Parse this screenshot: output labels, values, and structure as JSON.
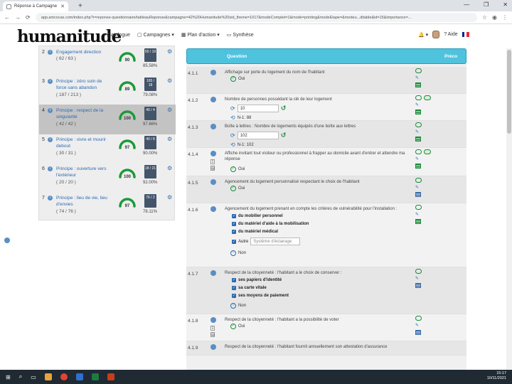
{
  "browser": {
    "tab_title": "Réponse à Campagne",
    "new_tab": "+",
    "controls": [
      "—",
      "❐",
      "✕"
    ],
    "url": "app.amcocas.com/index.php?r=reponse-questionnaire/tableauReponse&campagne=42%20Humanitude%20sid_theme=1017&modeComplet=1&mode=printing&modeEtape=&modeu...ditable&id=15&importance=..."
  },
  "appnav": {
    "logo": "humanitude",
    "menu": [
      {
        "icon": "≡",
        "label": "Catalogue"
      },
      {
        "icon": "▢",
        "label": "Campagnes ▾"
      },
      {
        "icon": "▦",
        "label": "Plan d'action ▾"
      },
      {
        "icon": "▭",
        "label": "Synthèse"
      }
    ],
    "bell": "🔔 ▾",
    "help": "Aide",
    "flag_colors": [
      "#002395",
      "#ffffff",
      "#ed2939"
    ]
  },
  "left_items": [
    {
      "num": "2",
      "title": "Engagement direction",
      "count": "( 62 / 63 )",
      "gauge": "90",
      "mini": "50 / 19",
      "pct": "85.58%",
      "highlight": false
    },
    {
      "num": "3",
      "title": "Principe : zéro soin de force sans abandon",
      "count": "( 187 / 213 )",
      "gauge": "89",
      "mini": "165 / 18",
      "pct": "79.08%",
      "highlight": false
    },
    {
      "num": "4",
      "title": "Principe : respect de la singularité",
      "count": "( 42 / 42 )",
      "gauge": "100",
      "mini": "40 / 4",
      "pct": "97.66%",
      "highlight": true
    },
    {
      "num": "5",
      "title": "Principe : vivre et mourir debout",
      "count": "( 30 / 31 )",
      "gauge": "97",
      "mini": "40 / 8",
      "pct": "90.00%",
      "highlight": false
    },
    {
      "num": "6",
      "title": "Principe : ouverture vers l'extérieur",
      "count": "( 20 / 20 )",
      "gauge": "100",
      "mini": "18 / 21",
      "pct": "92.00%",
      "highlight": false
    },
    {
      "num": "7",
      "title": "Principe : lieu de vie, lieu d'envies",
      "count": "( 74 / 76 )",
      "gauge": "97",
      "mini": "76 / 2",
      "pct": "78.11%",
      "highlight": false
    }
  ],
  "table": {
    "col_question": "Question",
    "col_preco": "Préco"
  },
  "questions": [
    {
      "id": "4.1.1",
      "text": "Affichage sur porte du logement du nom de l'habitant",
      "answer": "Oui"
    },
    {
      "id": "4.1.2",
      "text": "Nombre de personnes possédant la clé de leur logement",
      "value": "10",
      "n1": "N-1: 88"
    },
    {
      "id": "4.1.3",
      "text": "Boîte à lettres : Nombre de logements équipés d'une boîte aux lettres",
      "value": "102",
      "n1": "N-1: 102"
    },
    {
      "id": "4.1.4",
      "text": "Affiche invitant tout visiteur ou professionnel à frapper au domicile avant d'entrer et attendre ma réponse",
      "answer": "Oui"
    },
    {
      "id": "4.1.5",
      "text": "Agencement du logement personnalisé respectant le choix de l'habitant",
      "answer": "Oui"
    },
    {
      "id": "4.1.6",
      "text": "Agencement du logement prenant en compte les critères de vulnérabilité pour l'installation :",
      "checks": [
        "du mobilier personnel",
        "du matériel d'aide à la mobilisation",
        "du matériel médical"
      ],
      "other_label": "Autre",
      "other_placeholder": "Système d'éclairage",
      "answer": "Non"
    },
    {
      "id": "4.1.7",
      "text": "Respect de la citoyenneté : l'habitant a le choix de conserver :",
      "checks": [
        "ses papiers d'identité",
        "sa carte vitale",
        "ses moyens de paiement"
      ],
      "answer": "Non"
    },
    {
      "id": "4.1.8",
      "text": "Respect de la citoyenneté : l'habitant a la possibilité de voter",
      "answer": "Oui"
    },
    {
      "id": "4.1.9",
      "text": "Respect de la citoyenneté : l'habitant fournit annuellement son attestation d'assurance"
    }
  ],
  "taskbar": {
    "time": "15:17",
    "date": "10/11/2021"
  }
}
